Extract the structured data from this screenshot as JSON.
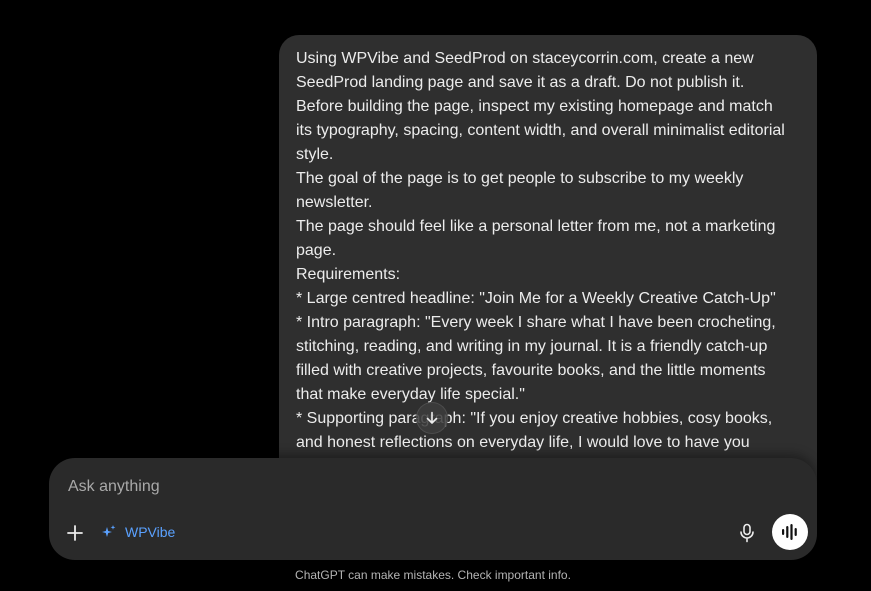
{
  "message": {
    "lines": [
      "Using WPVibe and SeedProd on staceycorrin.com, create a new",
      "SeedProd landing page and save it as a draft. Do not publish it.",
      "Before building the page, inspect my existing homepage and match",
      "its typography, spacing, content width, and overall minimalist editorial",
      "style.",
      "The goal of the page is to get people to subscribe to my weekly",
      "newsletter.",
      "The page should feel like a personal letter from me, not a marketing",
      "page.",
      "Requirements:",
      "* Large centred headline: \"Join Me for a Weekly Creative Catch-Up\"",
      "* Intro paragraph: \"Every week I share what I have been crocheting,",
      "stitching, reading, and writing in my journal. It is a friendly catch-up",
      "filled with creative projects, favourite books, and the little moments",
      "that make everyday life special.\"",
      "* Supporting paragraph: \"If you enjoy creative hobbies, cosy books,",
      "and honest reflections on everyday life, I would love to have you"
    ]
  },
  "composer": {
    "placeholder": "Ask anything",
    "tool_label": "WPVibe",
    "plus_icon": "plus-icon",
    "tool_icon": "sparkle-icon",
    "mic_icon": "microphone-icon",
    "voice_icon": "voice-waveform-icon"
  },
  "scroll_icon": "arrow-down-icon",
  "footer": {
    "disclaimer": "ChatGPT can make mistakes. Check important info."
  },
  "colors": {
    "background": "#000000",
    "bubble": "#2f2f2f",
    "composer": "#2a2a2a",
    "accent": "#5aa1ff",
    "text": "#ececec"
  }
}
